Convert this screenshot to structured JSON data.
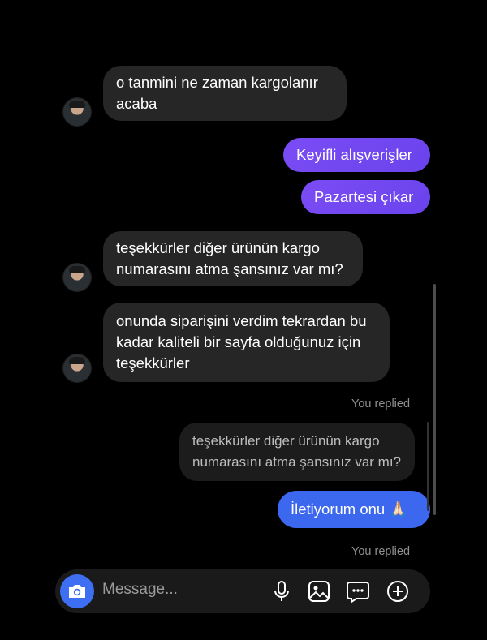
{
  "messages": [
    {
      "id": "m1",
      "text": "o tanmini ne zaman kargolanır acaba"
    },
    {
      "id": "m2",
      "text": "Keyifli alışverişler"
    },
    {
      "id": "m3",
      "text": "Pazartesi çıkar"
    },
    {
      "id": "m4",
      "text": "teşekkürler diğer ürünün kargo numarasını atma şansınız var mı?"
    },
    {
      "id": "m5",
      "text": "onunda siparişini verdim tekrardan bu kadar kaliteli bir sayfa olduğunuz için teşekkürler"
    },
    {
      "id": "m6",
      "text": "İletiyorum onu 🙏🏻"
    }
  ],
  "reply1": {
    "label": "You replied",
    "quoted": "teşekkürler diğer ürünün kargo numarasını atma şansınız var mı?"
  },
  "reply2": {
    "label": "You replied"
  },
  "composer": {
    "placeholder": "Message..."
  },
  "colors": {
    "outgoing_purple": "#7b4cf5",
    "outgoing_blue": "#3c67ef",
    "incoming": "#262626",
    "camera": "#3e6ff3"
  }
}
